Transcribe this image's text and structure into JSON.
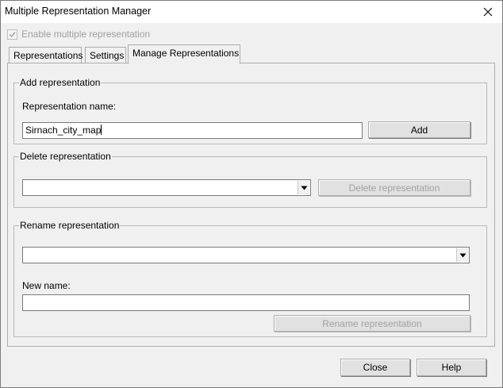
{
  "window": {
    "title": "Multiple Representation Manager"
  },
  "enable_checkbox": {
    "label": "Enable multiple representation",
    "checked": true,
    "disabled": true
  },
  "tabs": [
    {
      "label": "Representations",
      "active": false
    },
    {
      "label": "Settings",
      "active": false
    },
    {
      "label": "Manage Representations",
      "active": true
    }
  ],
  "add_group": {
    "legend": "Add representation",
    "name_label": "Representation name:",
    "name_value": "Sirnach_city_map",
    "add_label": "Add"
  },
  "delete_group": {
    "legend": "Delete representation",
    "selected": "",
    "delete_label": "Delete representation"
  },
  "rename_group": {
    "legend": "Rename representation",
    "selected": "",
    "new_name_label": "New name:",
    "new_name_value": "",
    "rename_label": "Rename representation"
  },
  "footer": {
    "close_label": "Close",
    "help_label": "Help"
  },
  "icons": {
    "close": "close-icon",
    "check": "checkmark-icon",
    "dropdown": "chevron-down-icon"
  }
}
